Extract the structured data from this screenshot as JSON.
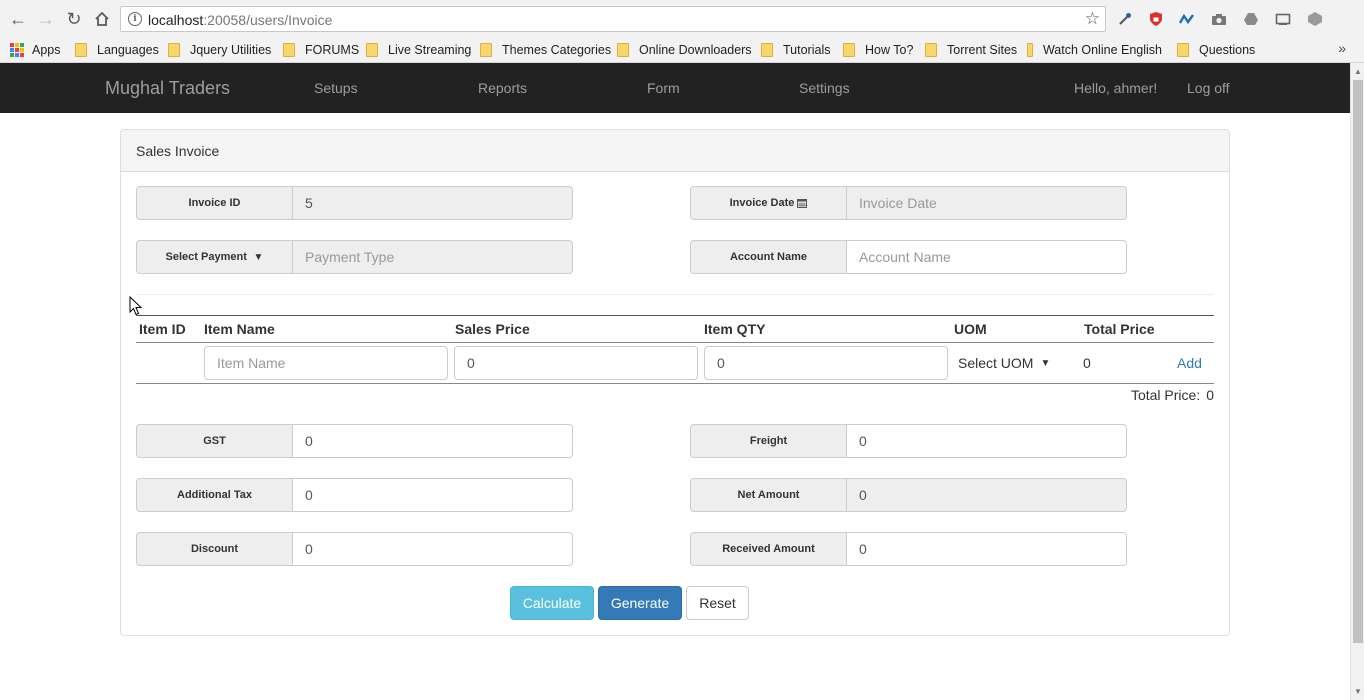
{
  "browser": {
    "url_host": "localhost",
    "url_rest": ":20058/users/Invoice",
    "bookmarks": [
      "Apps",
      "Languages",
      "Jquery Utilities",
      "FORUMS",
      "Live Streaming",
      "Themes Categories",
      "Online Downloaders",
      "Tutorials",
      "How To?",
      "Torrent Sites",
      "Watch Online English",
      "Questions"
    ],
    "more": "»"
  },
  "navbar": {
    "brand": "Mughal Traders",
    "links": [
      "Setups",
      "Reports",
      "Form",
      "Settings"
    ],
    "greeting": "Hello, ahmer!",
    "logoff": "Log off"
  },
  "panel": {
    "title": "Sales Invoice"
  },
  "form": {
    "invoice_id": {
      "label": "Invoice ID",
      "value": "5"
    },
    "invoice_date": {
      "label": "Invoice Date",
      "placeholder": "Invoice Date"
    },
    "payment_type": {
      "label": "Select Payment T",
      "caret": "▼",
      "placeholder": "Payment Type"
    },
    "account_name": {
      "label": "Account Name",
      "placeholder": "Account Name"
    }
  },
  "items_table": {
    "headers": [
      "Item ID",
      "Item Name",
      "Sales Price",
      "Item QTY",
      "UOM",
      "Total Price"
    ],
    "row": {
      "item_name_placeholder": "Item Name",
      "sales_price": "0",
      "item_qty": "0",
      "uom": "Select UOM",
      "total_price": "0",
      "add_label": "Add"
    },
    "total_label": "Total Price:",
    "total_value": "0"
  },
  "totals": {
    "gst": {
      "label": "GST",
      "value": "0"
    },
    "freight": {
      "label": "Freight",
      "value": "0"
    },
    "additional_tax": {
      "label": "Additional Tax",
      "value": "0"
    },
    "net_amount": {
      "label": "Net Amount",
      "value": "0"
    },
    "discount": {
      "label": "Discount",
      "value": "0"
    },
    "received_amount": {
      "label": "Received Amount",
      "value": "0"
    }
  },
  "buttons": {
    "calculate": "Calculate",
    "generate": "Generate",
    "reset": "Reset"
  },
  "colors": {
    "navbar": "#222222",
    "calculate": "#5bc0de",
    "generate": "#337ab7",
    "link": "#337ab7"
  },
  "icons": [
    "back-icon",
    "forward-icon",
    "reload-icon",
    "home-icon",
    "info-icon",
    "star-icon",
    "calendar-icon",
    "caret-down-icon"
  ]
}
